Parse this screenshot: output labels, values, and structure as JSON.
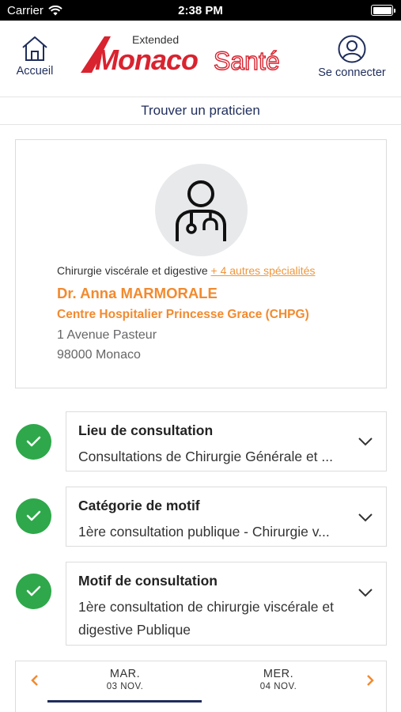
{
  "status_bar": {
    "carrier": "Carrier",
    "time": "2:38 PM",
    "battery_level": 1.0
  },
  "header": {
    "home_label": "Accueil",
    "login_label": "Se connecter",
    "logo": {
      "extended": "Extended",
      "monaco": "Monaco",
      "sante": "Santé"
    }
  },
  "subnav": {
    "title": "Trouver un praticien"
  },
  "practitioner": {
    "specialty": "Chirurgie viscérale et digestive",
    "more_specialties": "+ 4 autres spécialités",
    "name": "Dr. Anna MARMORALE",
    "hospital": "Centre Hospitalier Princesse Grace (CHPG)",
    "address_line1": "1 Avenue Pasteur",
    "address_line2": "98000 Monaco"
  },
  "steps": [
    {
      "title": "Lieu de consultation",
      "value": "Consultations de Chirurgie Générale et ..."
    },
    {
      "title": "Catégorie de motif",
      "value": "1ère consultation publique - Chirurgie v..."
    },
    {
      "title": "Motif de consultation",
      "value": "1ère consultation de chirurgie viscérale et digestive Publique"
    }
  ],
  "dates": [
    {
      "day": "MAR.",
      "date": "03 NOV."
    },
    {
      "day": "MER.",
      "date": "04 NOV."
    }
  ],
  "colors": {
    "accent_orange": "#f28a2e",
    "navy": "#1f2d5c",
    "success_green": "#2ea84a",
    "logo_red": "#d9232f"
  },
  "icons": {
    "home": "home-icon",
    "login": "user-circle-icon",
    "avatar": "doctor-icon",
    "check": "check-icon",
    "chevron": "chevron-down-icon",
    "prev": "chevron-left-icon",
    "next": "chevron-right-icon"
  }
}
